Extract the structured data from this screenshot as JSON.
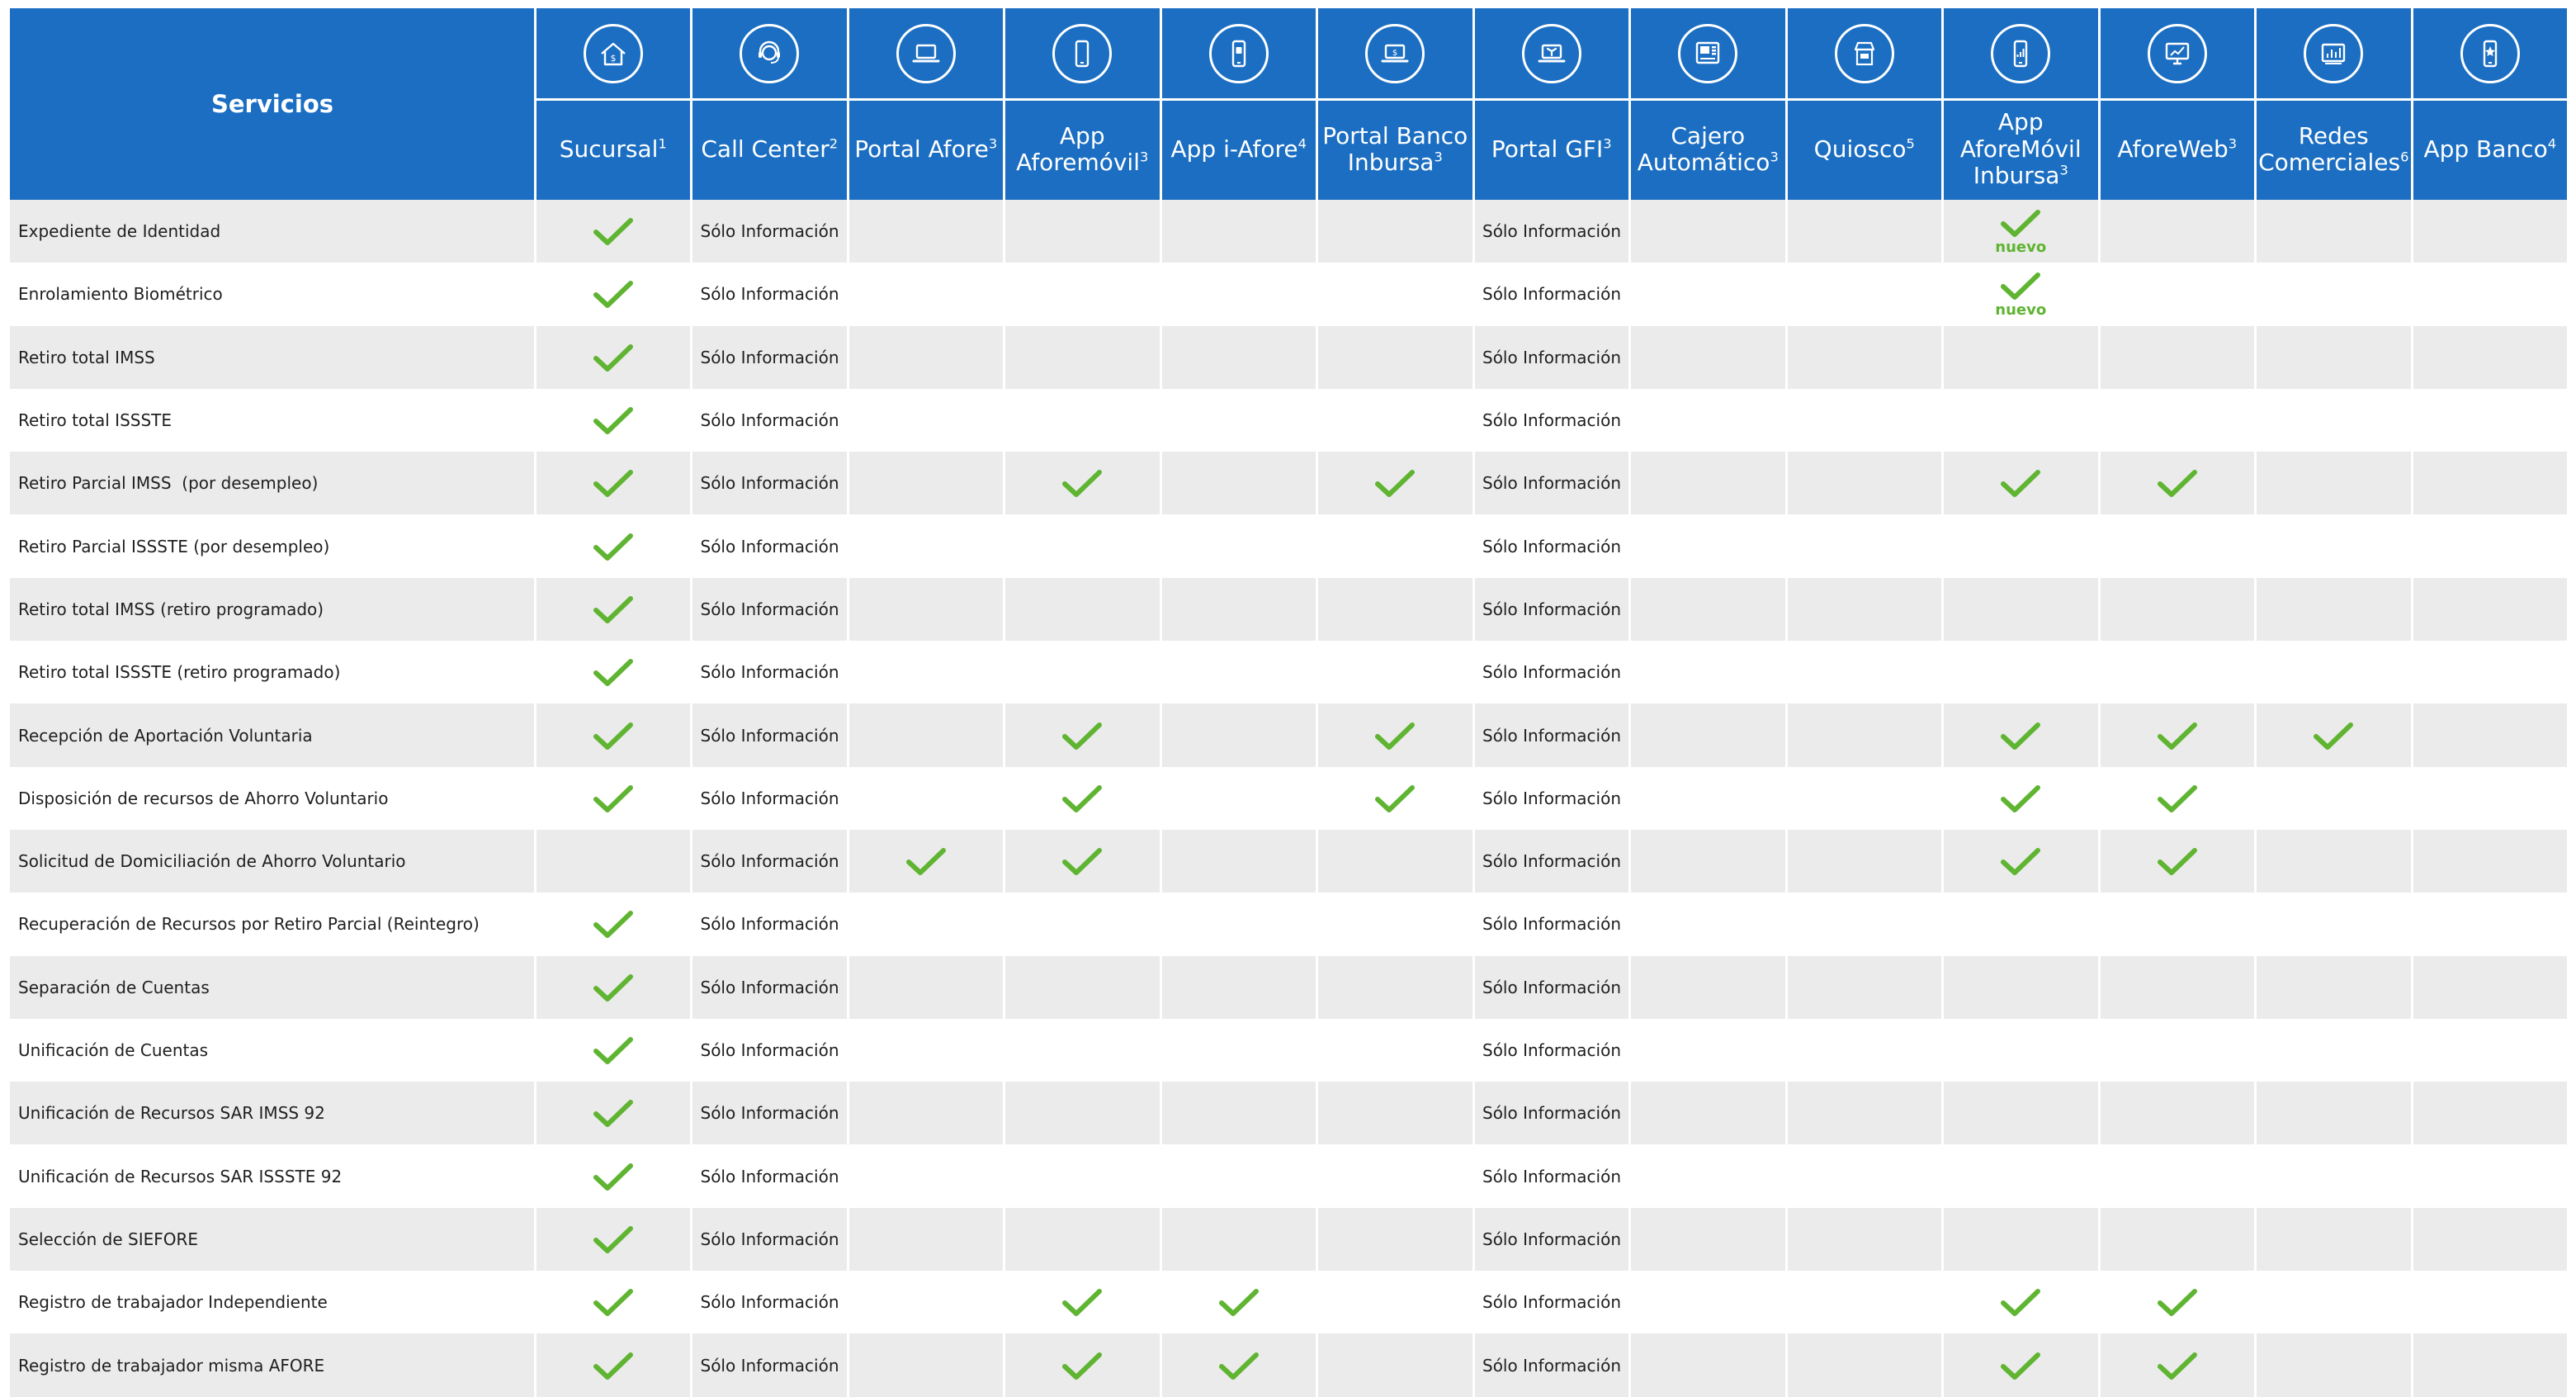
{
  "table": {
    "header_title": "Servicios",
    "columns": [
      {
        "label": "Sucursal",
        "sup": "1",
        "icon": "house-dollar-icon"
      },
      {
        "label": "Call Center",
        "sup": "2",
        "icon": "headset-icon"
      },
      {
        "label": "Portal Afore",
        "sup": "3",
        "icon": "laptop-icon"
      },
      {
        "label": "App Aforemóvil",
        "sup": "3",
        "icon": "smartphone-icon"
      },
      {
        "label": "App i-Afore",
        "sup": "4",
        "icon": "smartphone-app-icon"
      },
      {
        "label": "Portal Banco Inbursa",
        "sup": "3",
        "icon": "laptop-dollar-icon"
      },
      {
        "label": "Portal GFI",
        "sup": "3",
        "icon": "laptop-fan-icon"
      },
      {
        "label": "Cajero Automático",
        "sup": "3",
        "icon": "atm-icon"
      },
      {
        "label": "Quiosco",
        "sup": "5",
        "icon": "kiosk-icon"
      },
      {
        "label": "App AforeMóvil Inbursa",
        "sup": "3",
        "icon": "smartphone-chart-icon"
      },
      {
        "label": "AforeWeb",
        "sup": "3",
        "icon": "monitor-chart-icon"
      },
      {
        "label": "Redes Comerciales",
        "sup": "6",
        "icon": "store-chart-icon"
      },
      {
        "label": "App Banco",
        "sup": "4",
        "icon": "smartphone-star-icon"
      }
    ],
    "info_text": "Sólo Información",
    "new_label": "nuevo",
    "check_color": "#5fb431",
    "header_color": "#1b6ec2",
    "band_color": "#ebebeb",
    "rows": [
      {
        "service": "Expediente de Identidad",
        "cells": [
          "check",
          "info",
          "",
          "",
          "",
          "",
          "info",
          "",
          "",
          "check-new",
          "",
          "",
          ""
        ]
      },
      {
        "service": "Enrolamiento Biométrico",
        "cells": [
          "check",
          "info",
          "",
          "",
          "",
          "",
          "info",
          "",
          "",
          "check-new",
          "",
          "",
          ""
        ]
      },
      {
        "service": "Retiro total IMSS",
        "cells": [
          "check",
          "info",
          "",
          "",
          "",
          "",
          "info",
          "",
          "",
          "",
          "",
          "",
          ""
        ]
      },
      {
        "service": "Retiro total ISSSTE",
        "cells": [
          "check",
          "info",
          "",
          "",
          "",
          "",
          "info",
          "",
          "",
          "",
          "",
          "",
          ""
        ]
      },
      {
        "service": "Retiro Parcial IMSS  (por desempleo)",
        "cells": [
          "check",
          "info",
          "",
          "check",
          "",
          "check",
          "info",
          "",
          "",
          "check",
          "check",
          "",
          ""
        ]
      },
      {
        "service": "Retiro Parcial ISSSTE (por desempleo)",
        "cells": [
          "check",
          "info",
          "",
          "",
          "",
          "",
          "info",
          "",
          "",
          "",
          "",
          "",
          ""
        ]
      },
      {
        "service": "Retiro total IMSS (retiro programado)",
        "cells": [
          "check",
          "info",
          "",
          "",
          "",
          "",
          "info",
          "",
          "",
          "",
          "",
          "",
          ""
        ]
      },
      {
        "service": "Retiro total ISSSTE (retiro programado)",
        "cells": [
          "check",
          "info",
          "",
          "",
          "",
          "",
          "info",
          "",
          "",
          "",
          "",
          "",
          ""
        ]
      },
      {
        "service": "Recepción de Aportación Voluntaria",
        "cells": [
          "check",
          "info",
          "",
          "check",
          "",
          "check",
          "info",
          "",
          "",
          "check",
          "check",
          "check",
          ""
        ]
      },
      {
        "service": "Disposición de recursos de Ahorro Voluntario",
        "cells": [
          "check",
          "info",
          "",
          "check",
          "",
          "check",
          "info",
          "",
          "",
          "check",
          "check",
          "",
          ""
        ]
      },
      {
        "service": "Solicitud de Domiciliación de Ahorro Voluntario",
        "cells": [
          "",
          "info",
          "check",
          "check",
          "",
          "",
          "info",
          "",
          "",
          "check",
          "check",
          "",
          ""
        ]
      },
      {
        "service": "Recuperación de Recursos por Retiro Parcial (Reintegro)",
        "cells": [
          "check",
          "info",
          "",
          "",
          "",
          "",
          "info",
          "",
          "",
          "",
          "",
          "",
          ""
        ]
      },
      {
        "service": "Separación de Cuentas",
        "cells": [
          "check",
          "info",
          "",
          "",
          "",
          "",
          "info",
          "",
          "",
          "",
          "",
          "",
          ""
        ]
      },
      {
        "service": "Unificación de Cuentas",
        "cells": [
          "check",
          "info",
          "",
          "",
          "",
          "",
          "info",
          "",
          "",
          "",
          "",
          "",
          ""
        ]
      },
      {
        "service": "Unificación de Recursos SAR IMSS 92",
        "cells": [
          "check",
          "info",
          "",
          "",
          "",
          "",
          "info",
          "",
          "",
          "",
          "",
          "",
          ""
        ]
      },
      {
        "service": "Unificación de Recursos SAR ISSSTE 92",
        "cells": [
          "check",
          "info",
          "",
          "",
          "",
          "",
          "info",
          "",
          "",
          "",
          "",
          "",
          ""
        ]
      },
      {
        "service": "Selección de SIEFORE",
        "cells": [
          "check",
          "info",
          "",
          "",
          "",
          "",
          "info",
          "",
          "",
          "",
          "",
          "",
          ""
        ]
      },
      {
        "service": "Registro de trabajador Independiente",
        "cells": [
          "check",
          "info",
          "",
          "check",
          "check",
          "",
          "info",
          "",
          "",
          "check",
          "check",
          "",
          ""
        ]
      },
      {
        "service": "Registro de trabajador misma AFORE",
        "cells": [
          "check",
          "info",
          "",
          "check",
          "check",
          "",
          "info",
          "",
          "",
          "check",
          "check",
          "",
          ""
        ]
      }
    ]
  }
}
